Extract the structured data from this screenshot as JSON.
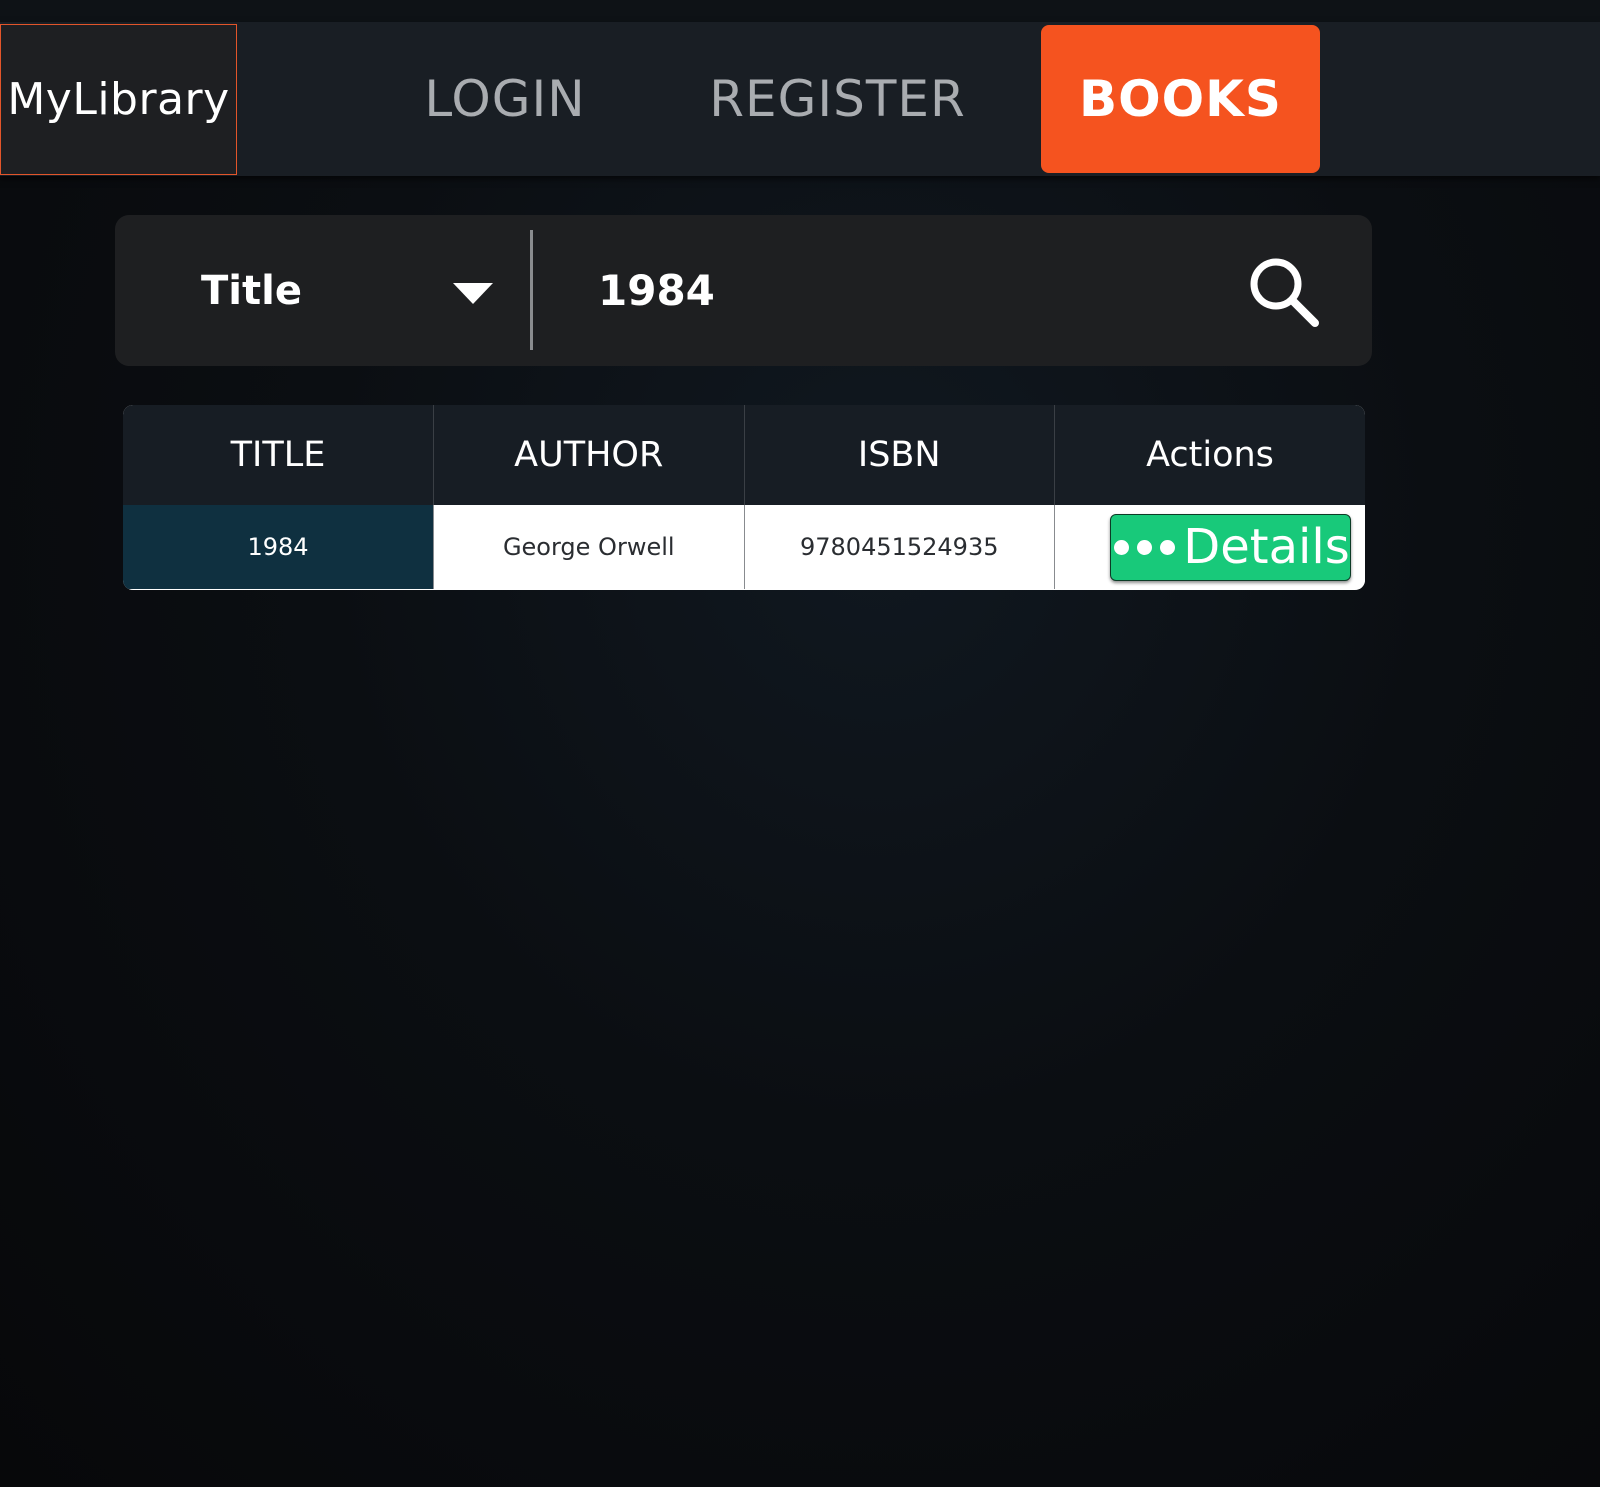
{
  "header": {
    "brand": "MyLibrary",
    "nav": {
      "login": "LOGIN",
      "register": "REGISTER",
      "books": "BOOKS"
    },
    "active_color": "#f5531f"
  },
  "search": {
    "filter_selected": "Title",
    "query": "1984",
    "search_icon": "search-icon",
    "dropdown_icon": "chevron-down-icon"
  },
  "table": {
    "headers": [
      "TITLE",
      "AUTHOR",
      "ISBN",
      "Actions"
    ],
    "rows": [
      {
        "title": "1984",
        "author": "George Orwell",
        "isbn": "9780451524935",
        "action_label": "Details",
        "action_icon": "more-dots-icon"
      }
    ],
    "details_color": "#18c97a"
  }
}
